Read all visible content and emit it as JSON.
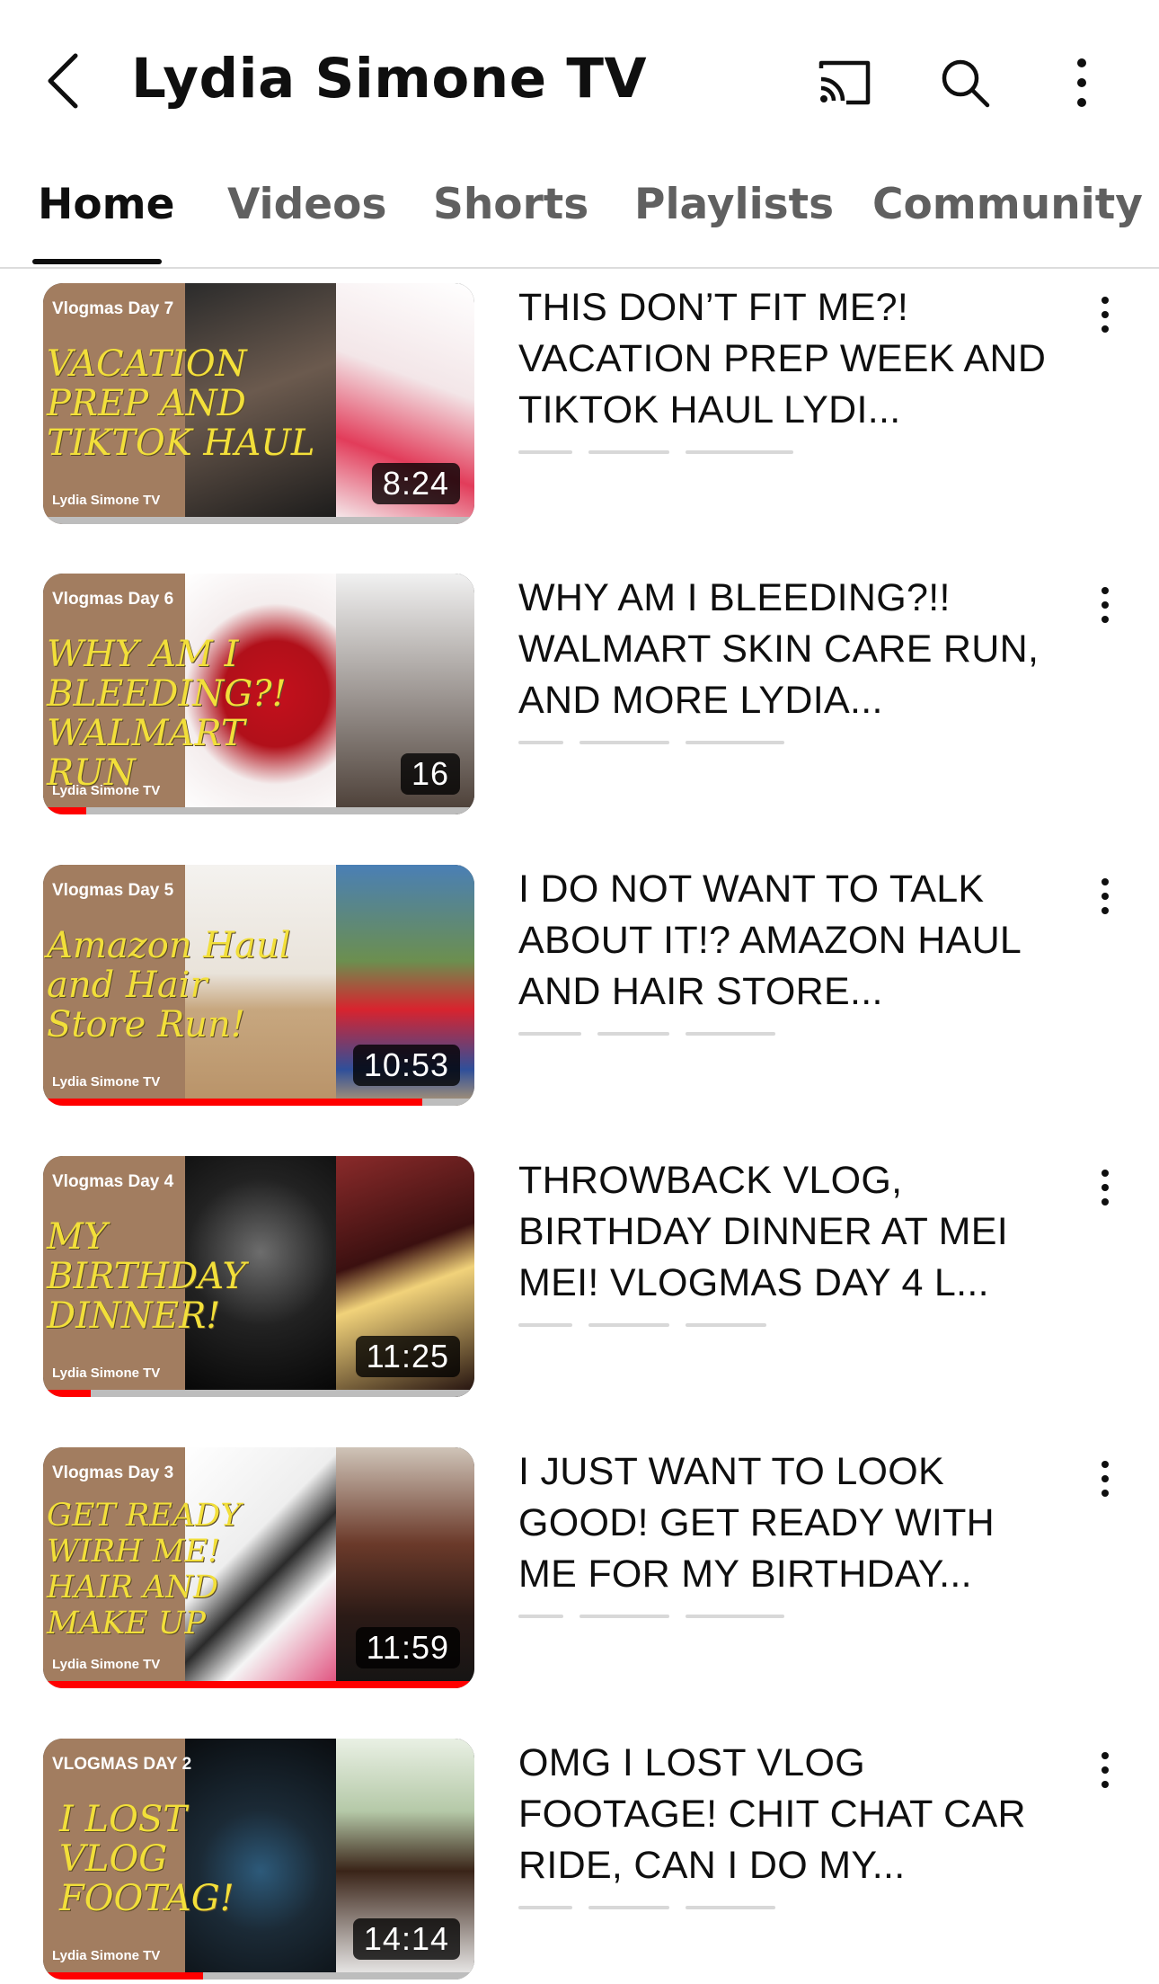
{
  "header": {
    "title": "Lydia Simone TV",
    "icons": [
      "back-arrow-icon",
      "cast-icon",
      "search-icon",
      "more-vertical-icon"
    ]
  },
  "tabs": [
    {
      "label": "Home",
      "active": true
    },
    {
      "label": "Videos",
      "active": false
    },
    {
      "label": "Shorts",
      "active": false
    },
    {
      "label": "Playlists",
      "active": false
    },
    {
      "label": "Community",
      "active": false
    }
  ],
  "videos": [
    {
      "title": "THIS DON’T FIT ME?! VACATION PREP WEEK AND TIKTOK HAUL LYDI...",
      "thumb_day": "Vlogmas Day 7",
      "thumb_caption": "VACATION\nPREP AND\nTIKTOK HAUL",
      "thumb_channel": "Lydia Simone TV",
      "duration": "8:24",
      "progress": 0
    },
    {
      "title": "WHY AM I BLEEDING?!! WALMART SKIN CARE RUN, AND MORE LYDIA...",
      "thumb_day": "Vlogmas Day 6",
      "thumb_caption": "WHY AM I\nBLEEDING?!\nWALMART RUN",
      "thumb_channel": "Lydia Simone TV",
      "duration": "16",
      "progress": 0.1
    },
    {
      "title": "I DO NOT WANT TO TALK ABOUT IT!? AMAZON HAUL AND HAIR STORE...",
      "thumb_day": "Vlogmas Day 5",
      "thumb_caption": "Amazon Haul\nand Hair\nStore Run!",
      "thumb_channel": "Lydia Simone TV",
      "duration": "10:53",
      "progress": 0.88
    },
    {
      "title": "THROWBACK VLOG, BIRTHDAY DINNER AT MEI MEI!  VLOGMAS DAY 4 L...",
      "thumb_day": "Vlogmas Day 4",
      "thumb_caption": "MY\nBIRTHDAY\nDINNER!",
      "thumb_channel": "Lydia Simone TV",
      "duration": "11:25",
      "progress": 0.11
    },
    {
      "title": "I JUST WANT TO LOOK GOOD! GET READY WITH ME FOR MY BIRTHDAY...",
      "thumb_day": "Vlogmas Day 3",
      "thumb_caption": "GET READY\nWIRH ME!\nHAIR AND\nMAKE UP",
      "thumb_channel": "Lydia Simone TV",
      "duration": "11:59",
      "progress": 1
    },
    {
      "title": "OMG I LOST VLOG FOOTAGE! CHIT CHAT CAR RIDE, CAN I DO MY...",
      "thumb_day": "VLOGMAS DAY 2",
      "thumb_caption": "I LOST\nVLOG\nFOOTAG!",
      "thumb_channel": "Lydia Simone TV",
      "duration": "14:14",
      "progress": 0.37
    }
  ],
  "colors": {
    "accent": "#ff0000",
    "thumb_panel": "#a27d60",
    "thumb_caption": "#f2df3a",
    "text": "#0f0f0f",
    "tab_inactive": "#606060"
  }
}
